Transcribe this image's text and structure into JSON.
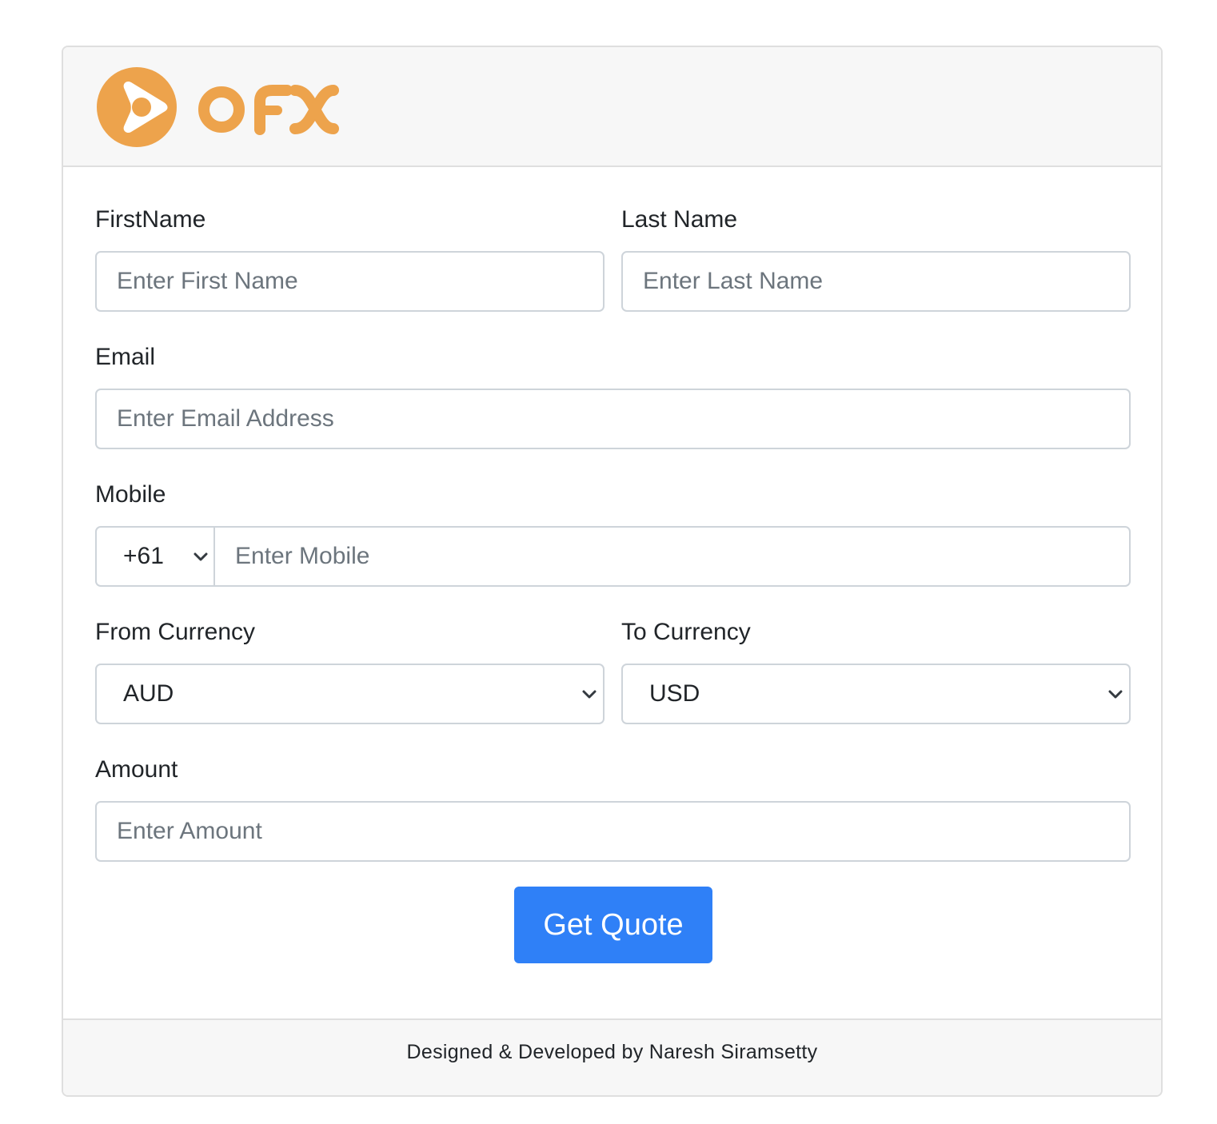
{
  "brand": {
    "logo_text": "OFX",
    "color": "#EDA34C"
  },
  "form": {
    "first_name": {
      "label": "FirstName",
      "placeholder": "Enter First Name",
      "value": ""
    },
    "last_name": {
      "label": "Last Name",
      "placeholder": "Enter Last Name",
      "value": ""
    },
    "email": {
      "label": "Email",
      "placeholder": "Enter Email Address",
      "value": ""
    },
    "mobile": {
      "label": "Mobile",
      "country_code": "+61",
      "placeholder": "Enter Mobile",
      "value": ""
    },
    "from_currency": {
      "label": "From Currency",
      "selected": "AUD"
    },
    "to_currency": {
      "label": "To Currency",
      "selected": "USD"
    },
    "amount": {
      "label": "Amount",
      "placeholder": "Enter Amount",
      "value": ""
    },
    "submit_label": "Get Quote"
  },
  "footer": {
    "text": "Designed & Developed by Naresh Siramsetty"
  },
  "colors": {
    "primary_button": "#2F80F7",
    "header_bg": "#F7F7F7",
    "border": "#DFDFDF"
  }
}
